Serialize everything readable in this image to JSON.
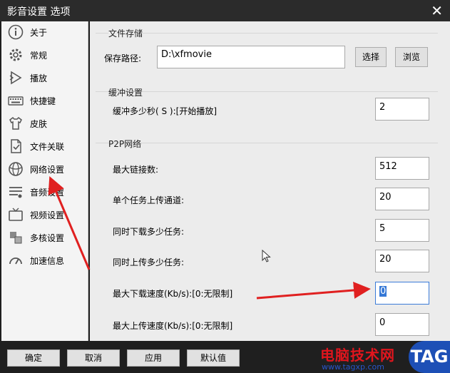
{
  "window": {
    "title": "影音设置 选项",
    "close": "✕"
  },
  "sidebar": {
    "items": [
      {
        "label": "关于",
        "icon": "info-icon"
      },
      {
        "label": "常规",
        "icon": "gear-icon"
      },
      {
        "label": "播放",
        "icon": "play-icon"
      },
      {
        "label": "快捷键",
        "icon": "keyboard-icon"
      },
      {
        "label": "皮肤",
        "icon": "shirt-icon"
      },
      {
        "label": "文件关联",
        "icon": "file-icon"
      },
      {
        "label": "网络设置",
        "icon": "globe-icon"
      },
      {
        "label": "音频设置",
        "icon": "audio-icon"
      },
      {
        "label": "视频设置",
        "icon": "tv-icon"
      },
      {
        "label": "多核设置",
        "icon": "cpu-icon"
      },
      {
        "label": "加速信息",
        "icon": "speed-icon"
      }
    ]
  },
  "storage": {
    "title": "文件存储",
    "path_label": "保存路径:",
    "path_value": "D:\\xfmovie",
    "select_button": "选择",
    "browse_button": "浏览"
  },
  "buffer": {
    "title": "缓冲设置",
    "seconds_label": "缓冲多少秒( S ):[开始播放]",
    "seconds_value": "2"
  },
  "p2p": {
    "title": "P2P网络",
    "fields": [
      {
        "label": "最大链接数:",
        "value": "512"
      },
      {
        "label": "单个任务上传通道:",
        "value": "20"
      },
      {
        "label": "同时下载多少任务:",
        "value": "5"
      },
      {
        "label": "同时上传多少任务:",
        "value": "20"
      },
      {
        "label": "最大下载速度(Kb/s):[0:无限制]",
        "value": "0"
      },
      {
        "label": "最大上传速度(Kb/s):[0:无限制]",
        "value": "0"
      }
    ]
  },
  "footer": {
    "ok": "确定",
    "cancel": "取消",
    "apply": "应用",
    "default": "默认值"
  },
  "watermark": {
    "text": "电脑技术网",
    "url": "www.tagxp.com",
    "logo": "TAG"
  },
  "colors": {
    "arrow": "#e02020",
    "focus": "#3578d6"
  }
}
